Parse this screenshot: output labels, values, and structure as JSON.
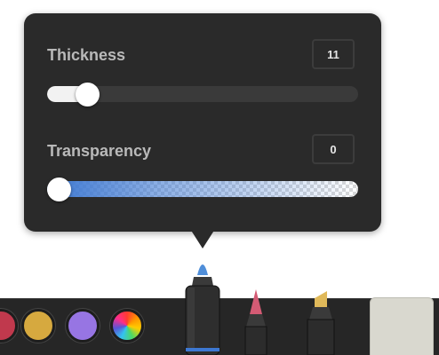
{
  "popover": {
    "thickness": {
      "label": "Thickness",
      "value": "11",
      "fraction": 0.1
    },
    "transparency": {
      "label": "Transparency",
      "value": "0",
      "fraction": 0.0
    }
  },
  "toolbar": {
    "swatches": [
      {
        "name": "red-swatch",
        "color": "#c0394d"
      },
      {
        "name": "yellow-swatch",
        "color": "#d6a93f"
      },
      {
        "name": "purple-swatch",
        "color": "#9775e3"
      },
      {
        "name": "multicolor-swatch",
        "color": "rainbow"
      }
    ],
    "tools": [
      {
        "name": "marker-tool",
        "tip_color": "#4f8ed9",
        "selected": true
      },
      {
        "name": "pen-tool",
        "tip_color": "#d45b74",
        "selected": false
      },
      {
        "name": "highlighter-tool",
        "tip_color": "#e0b95a",
        "selected": false
      },
      {
        "name": "eraser-tool",
        "selected": false
      }
    ]
  },
  "colors": {
    "popover_bg": "#2a2a2a",
    "toolbar_bg": "#262626",
    "accent_blue": "#3d78d2"
  }
}
